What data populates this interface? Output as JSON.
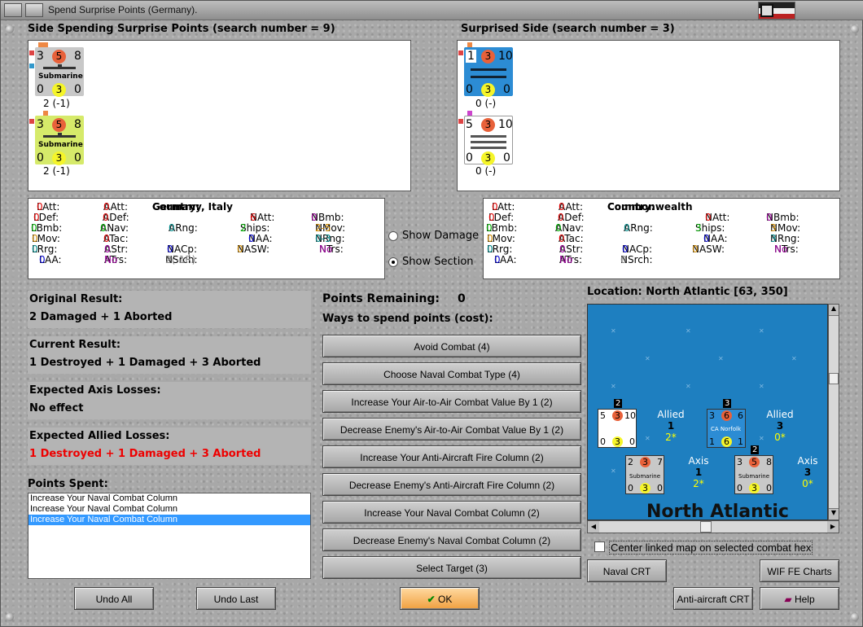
{
  "window": {
    "title": "Spend Surprise Points (Germany)."
  },
  "left_panel": {
    "title": "Side Spending Surprise Points (search number = 9)",
    "units": [
      {
        "top": "3",
        "mid": "5",
        "right": "8",
        "name": "Submarine",
        "b1": "0",
        "b2": "3",
        "b3": "0",
        "below": "2 (-1)",
        "bg": "#c8c8c8"
      },
      {
        "top": "3",
        "mid": "5",
        "right": "8",
        "name": "Submarine",
        "b1": "0",
        "b2": "3",
        "b3": "0",
        "below": "2 (-1)",
        "bg": "#d6ea6a"
      }
    ]
  },
  "right_panel": {
    "title": "Surprised Side (search number = 3)",
    "units": [
      {
        "top": "1",
        "mid": "3",
        "right": "10",
        "b1": "0",
        "b2": "3",
        "b3": "0",
        "below": "0 (-)",
        "bg": "#2c8cd4"
      },
      {
        "top": "5",
        "mid": "3",
        "right": "10",
        "b1": "0",
        "b2": "3",
        "b3": "0",
        "below": "0 (-)",
        "bg": "#ffffff"
      }
    ]
  },
  "stats_left": {
    "country_label": "Country:",
    "country": "Germany, Italy",
    "latt": "0",
    "aatt": "0",
    "natt": "6",
    "nbmb": "0",
    "ldef": "0",
    "adef": "0",
    "nmov": "2-5",
    "lbmb": "0",
    "anav": "0",
    "arng": "0",
    "ships": "2",
    "nrng": "0-3",
    "lmov": "0",
    "atac": "0",
    "naa": "0",
    "ntrs": "No",
    "lrrg": "0",
    "astr": "0",
    "nacp": "0",
    "nasw": "0",
    "laa": "0",
    "atrs": "No",
    "nsrch": "2(-1R)"
  },
  "stats_right": {
    "country_label": "Country:",
    "country": "Commonwealth",
    "latt": "0",
    "aatt": "0",
    "natt": "0",
    "nbmb": "0",
    "ldef": "0",
    "adef": "0",
    "nmov": "3",
    "lbmb": "0",
    "anav": "0",
    "arng": "0",
    "ships": "3",
    "nrng": "3",
    "lmov": "0",
    "atac": "0",
    "naa": "0",
    "ntrs": "No",
    "lrrg": "0",
    "astr": "0",
    "nacp": "0",
    "nasw": "0",
    "laa": "0",
    "atrs": "No",
    "nsrch": "0"
  },
  "stat_labels": {
    "latt": "LAtt:",
    "aatt": "AAtt:",
    "natt": "NAtt:",
    "nbmb": "NBmb:",
    "ldef": "LDef:",
    "adef": "ADef:",
    "nmov": "NMov:",
    "lbmb": "LBmb:",
    "anav": "ANav:",
    "arng": "ARng:",
    "ships": "Ships:",
    "nrng": "NRng:",
    "lmov": "LMov:",
    "atac": "ATac:",
    "naa": "NAA:",
    "ntrs": "NTrs:",
    "lrrg": "LRrg:",
    "astr": "AStr:",
    "nacp": "NACp:",
    "nasw": "NASW:",
    "laa": "LAA:",
    "atrs": "ATrs:",
    "nsrch": "NSrch:"
  },
  "options": {
    "show_damage": "Show Damage",
    "show_section": "Show Section"
  },
  "results": {
    "original_label": "Original Result:",
    "original": "2 Damaged + 1 Aborted",
    "current_label": "Current Result:",
    "current": "1 Destroyed + 1 Damaged + 3 Aborted",
    "axis_label": "Expected Axis Losses:",
    "axis": "No effect",
    "allied_label": "Expected Allied Losses:",
    "allied": "1 Destroyed + 1 Damaged + 3 Aborted"
  },
  "points_spent": {
    "label": "Points Spent:",
    "items": [
      "Increase Your Naval Combat Column",
      "Increase Your Naval Combat Column",
      "Increase Your Naval Combat Column"
    ]
  },
  "spend": {
    "remaining_label": "Points Remaining:",
    "remaining": "0",
    "ways_label": "Ways to spend points (cost):",
    "buttons": [
      "Avoid Combat (4)",
      "Choose Naval Combat Type (4)",
      "Increase Your Air-to-Air Combat Value By 1 (2)",
      "Decrease Enemy's Air-to-Air Combat Value By 1 (2)",
      "Increase Your Anti-Aircraft Fire Column (2)",
      "Decrease Enemy's Anti-Aircraft Fire Column (2)",
      "Increase Your Naval Combat Column (2)",
      "Decrease Enemy's Naval Combat Column (2)",
      "Select Target (3)"
    ]
  },
  "location": {
    "label": "Location: North Atlantic [63, 350]",
    "sea_name": "North Atlantic",
    "allied1_label": "Allied",
    "allied1_val": "1",
    "allied1_sub": "2*",
    "allied2_label": "Allied",
    "allied2_val": "3",
    "allied2_sub": "0*",
    "axis1_label": "Axis",
    "axis1_val": "1",
    "axis1_sub": "2*",
    "axis2_label": "Axis",
    "axis2_val": "3",
    "axis2_sub": "0*",
    "ship_name": "CA Norfolk",
    "sub_name": "Submarine",
    "stack1": "2",
    "stack2": "3",
    "stack3": "2"
  },
  "center_linked": "Center linked map on selected combat hex",
  "bottom": {
    "undo_all": "Undo All",
    "undo_last": "Undo Last",
    "ok": "OK",
    "naval_crt": "Naval CRT",
    "wif_charts": "WIF FE Charts",
    "aa_crt": "Anti-aircraft CRT",
    "help": "Help"
  }
}
